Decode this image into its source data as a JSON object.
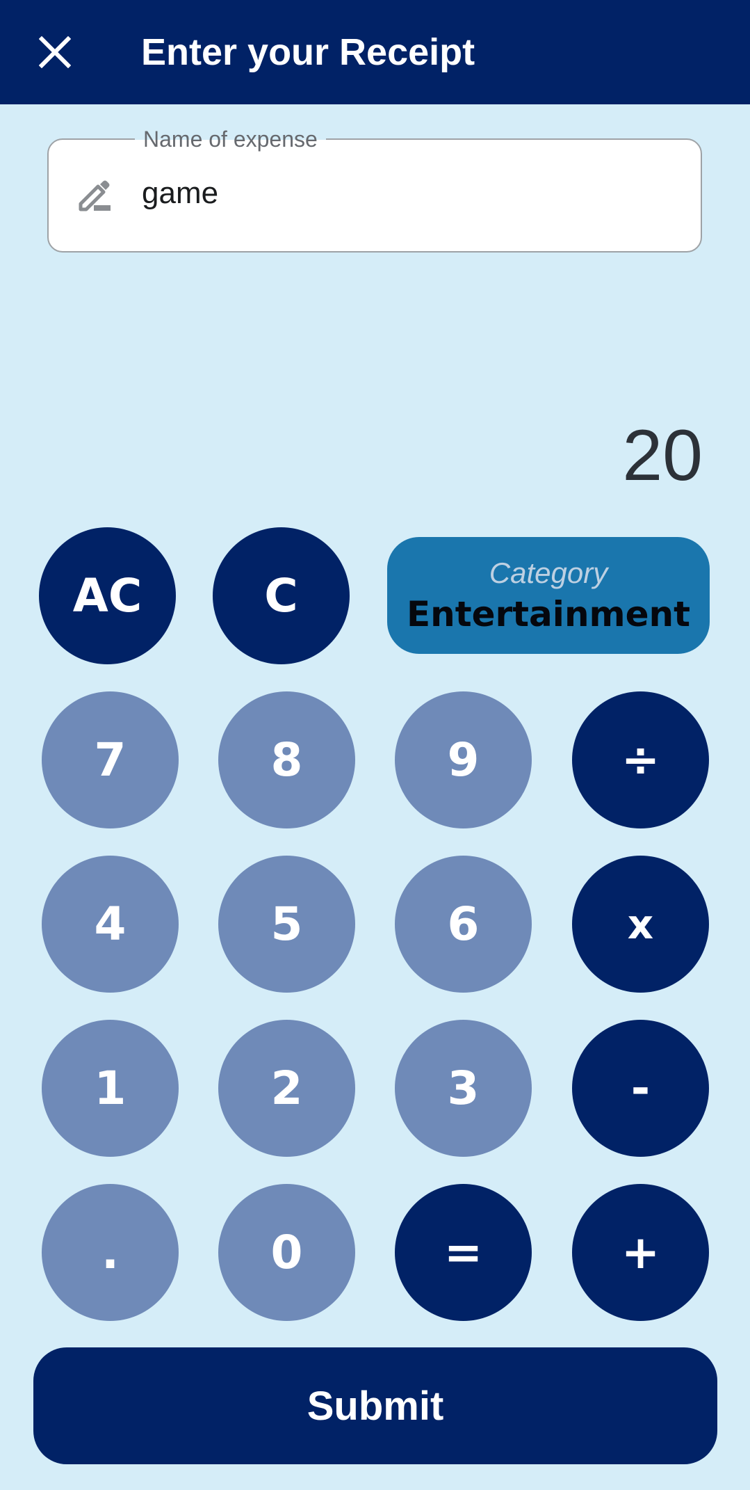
{
  "appbar": {
    "title": "Enter your Receipt",
    "close_icon": "close-icon"
  },
  "expense_field": {
    "label": "Name of expense",
    "value": "game",
    "icon": "pencil-icon"
  },
  "display": {
    "value": "20"
  },
  "category": {
    "label": "Category",
    "value": "Entertainment"
  },
  "keys": {
    "ac": "AC",
    "c": "C",
    "seven": "7",
    "eight": "8",
    "nine": "9",
    "divide": "÷",
    "four": "4",
    "five": "5",
    "six": "6",
    "multiply": "x",
    "one": "1",
    "two": "2",
    "three": "3",
    "minus": "-",
    "dot": ".",
    "zero": "0",
    "equals": "=",
    "plus": "+"
  },
  "submit": {
    "label": "Submit"
  },
  "colors": {
    "primary": "#012266",
    "background": "#d5edf8",
    "number_key": "#6f8ab8",
    "category_bg": "#1a76ad"
  }
}
